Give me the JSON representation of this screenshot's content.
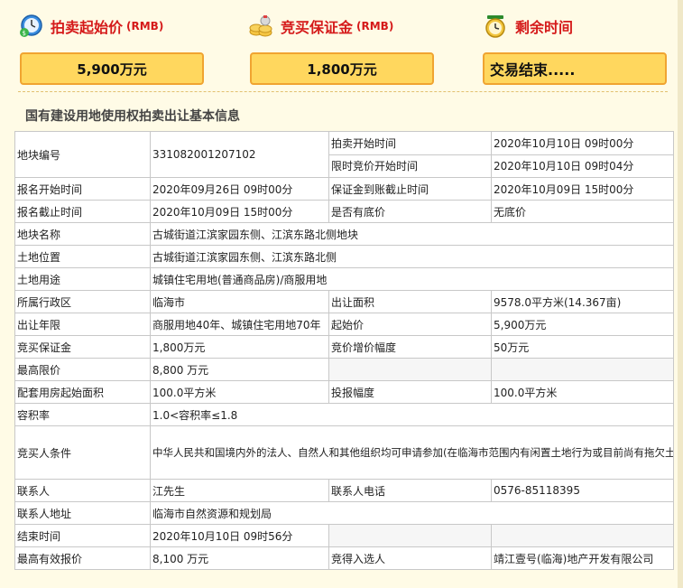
{
  "header": {
    "start_price": {
      "icon": "clock-money-icon",
      "label": "拍卖起始价",
      "unit": "(RMB)",
      "value": "5,900万元"
    },
    "deposit": {
      "icon": "coins-icon",
      "label": "竞买保证金",
      "unit": "(RMB)",
      "value": "1,800万元"
    },
    "remaining": {
      "icon": "alarm-clock-icon",
      "label": "剩余时间",
      "value": "交易结束....."
    }
  },
  "section_title": "国有建设用地使用权拍卖出让基本信息",
  "rows": {
    "r1": {
      "k1": "地块编号",
      "v1": "331082001207102",
      "k2": "拍卖开始时间",
      "v2": "2020年10月10日 09时00分"
    },
    "r2": {
      "k2": "限时竞价开始时间",
      "v2": "2020年10月10日 09时04分"
    },
    "r3": {
      "k1": "报名开始时间",
      "v1": "2020年09月26日 09时00分",
      "k2": "保证金到账截止时间",
      "v2": "2020年10月09日 15时00分"
    },
    "r4": {
      "k1": "报名截止时间",
      "v1": "2020年10月09日 15时00分",
      "k2": "是否有底价",
      "v2": "无底价"
    },
    "r5": {
      "k1": "地块名称",
      "v1": "古城街道江滨家园东侧、江滨东路北侧地块"
    },
    "r6": {
      "k1": "土地位置",
      "v1": "古城街道江滨家园东侧、江滨东路北侧"
    },
    "r7": {
      "k1": "土地用途",
      "v1": "城镇住宅用地(普通商品房)/商服用地"
    },
    "r8": {
      "k1": "所属行政区",
      "v1": "临海市",
      "k2": "出让面积",
      "v2": "9578.0平方米(14.367亩)"
    },
    "r9": {
      "k1": "出让年限",
      "v1": "商服用地40年、城镇住宅用地70年",
      "k2": "起始价",
      "v2": "5,900万元"
    },
    "r10": {
      "k1": "竞买保证金",
      "v1": "1,800万元",
      "k2": "竞价增价幅度",
      "v2": "50万元"
    },
    "r11": {
      "k1": "最高限价",
      "v1": "8,800 万元"
    },
    "r12": {
      "k1": "配套用房起始面积",
      "v1": "100.0平方米",
      "k2": "投报幅度",
      "v2": "100.0平方米"
    },
    "r13": {
      "k1": "容积率",
      "v1": "1.0<容积率≤1.8"
    },
    "r14": {
      "k1": "竞买人条件",
      "v1": "中华人民共和国境内外的法人、自然人和其他组织均可申请参加(在临海市范围内有闲置土地行为或目前尚有拖欠土地出让金行为的、法律法规及有关政策另有规定的除外),申请人可以单独申请也可以联合申请。"
    },
    "r15": {
      "k1": "联系人",
      "v1": "江先生",
      "k2": "联系人电话",
      "v2": "0576-85118395"
    },
    "r16": {
      "k1": "联系人地址",
      "v1": "临海市自然资源和规划局"
    },
    "r17": {
      "k1": "结束时间",
      "v1": "2020年10月10日 09时56分"
    },
    "r18": {
      "k1": "最高有效报价",
      "v1": "8,100 万元",
      "k2": "竞得入选人",
      "v2": "靖江壹号(临海)地产开发有限公司"
    }
  }
}
